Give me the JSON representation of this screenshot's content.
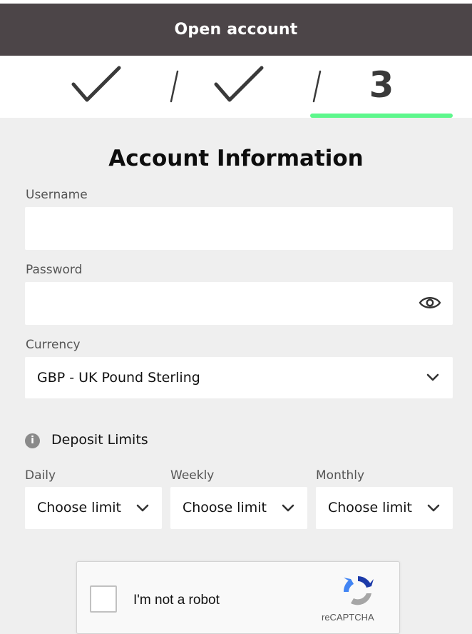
{
  "header": {
    "title": "Open account"
  },
  "steps": {
    "step1_icon": "check-icon",
    "step2_icon": "check-icon",
    "current_step": "3",
    "accent_color": "#5df78c"
  },
  "form": {
    "title": "Account Information",
    "username": {
      "label": "Username",
      "value": ""
    },
    "password": {
      "label": "Password",
      "value": "",
      "toggle_icon": "eye-icon"
    },
    "currency": {
      "label": "Currency",
      "value": "GBP - UK Pound Sterling"
    },
    "deposit_limits": {
      "label": "Deposit Limits",
      "daily": {
        "label": "Daily",
        "value": "Choose limit"
      },
      "weekly": {
        "label": "Weekly",
        "value": "Choose limit"
      },
      "monthly": {
        "label": "Monthly",
        "value": "Choose limit"
      }
    }
  },
  "captcha": {
    "label": "I'm not a robot",
    "brand": "reCAPTCHA"
  },
  "colors": {
    "header_bg": "#4c4548",
    "page_bg": "#efefef"
  }
}
